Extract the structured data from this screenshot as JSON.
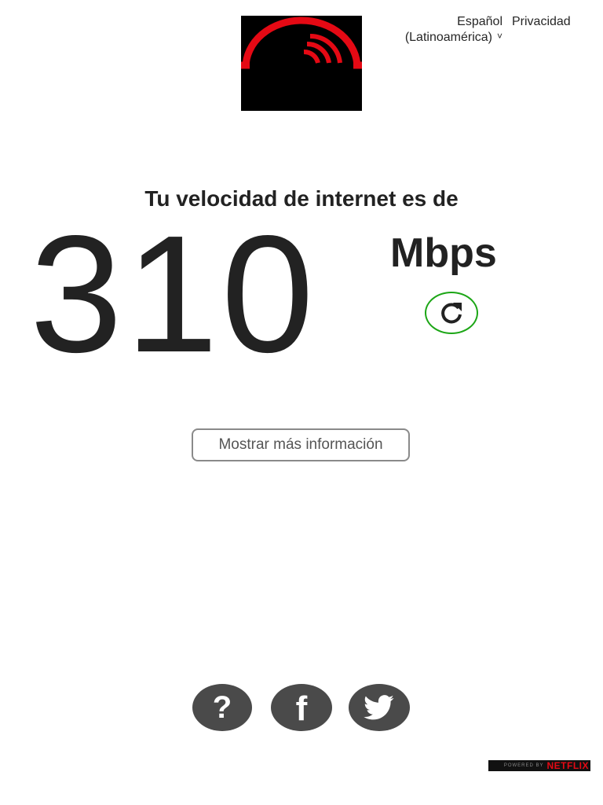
{
  "header": {
    "language_label_line1": "Español",
    "language_label_line2": "(Latinoamérica)",
    "language_chevron": "˅",
    "privacy_label": "Privacidad"
  },
  "main": {
    "headline": "Tu velocidad de internet es de",
    "speed_value": "310",
    "speed_units": "Mbps",
    "refresh_icon": "refresh-icon",
    "more_info_label": "Mostrar más información"
  },
  "footer": {
    "help_glyph": "?",
    "facebook_glyph": "f",
    "twitter_icon": "twitter-bird-icon",
    "powered_by": "POWERED BY",
    "brand": "NETFLIX"
  },
  "colors": {
    "logo_bg": "#000000",
    "logo_accent": "#e50914",
    "refresh_ring": "#1ca616",
    "social_bg": "#4a4a4a",
    "text": "#222222"
  }
}
